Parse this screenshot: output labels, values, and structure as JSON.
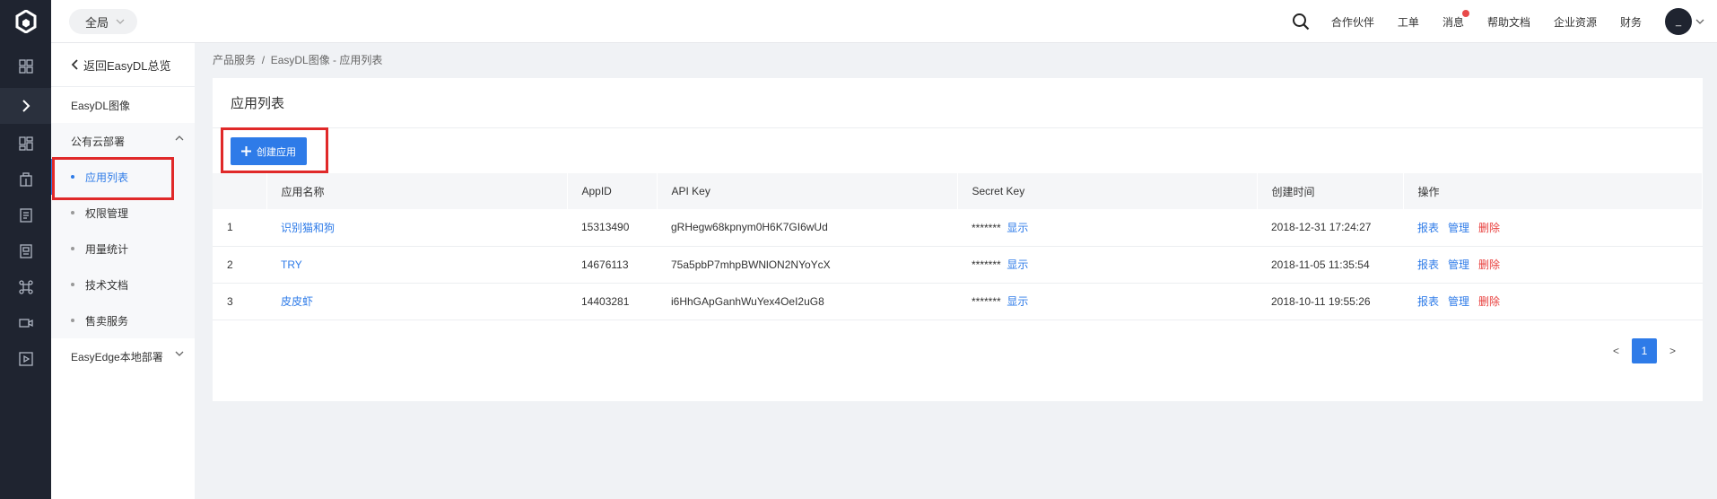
{
  "topbar": {
    "scope": "全局",
    "nav": [
      "合作伙伴",
      "工单",
      "消息",
      "帮助文档",
      "企业资源",
      "财务"
    ],
    "avatar_text": "_"
  },
  "sidebar": {
    "back": "返回EasyDL总览",
    "product": "EasyDL图像",
    "group_public": "公有云部署",
    "sub_items": [
      "应用列表",
      "权限管理",
      "用量统计",
      "技术文档",
      "售卖服务"
    ],
    "group_edge": "EasyEdge本地部署"
  },
  "breadcrumb": {
    "parent": "产品服务",
    "sep": "/",
    "current": "EasyDL图像 - 应用列表"
  },
  "page": {
    "title": "应用列表",
    "create_button": "创建应用"
  },
  "table": {
    "headers": [
      "",
      "应用名称",
      "AppID",
      "API Key",
      "Secret Key",
      "创建时间",
      "操作"
    ],
    "rows": [
      {
        "idx": "1",
        "name": "识别猫和狗",
        "appid": "15313490",
        "apikey": "gRHegw68kpnym0H6K7GI6wUd",
        "secret": "*******",
        "show": "显示",
        "created": "2018-12-31 17:24:27"
      },
      {
        "idx": "2",
        "name": "TRY",
        "appid": "14676113",
        "apikey": "75a5pbP7mhpBWNlON2NYoYcX",
        "secret": "*******",
        "show": "显示",
        "created": "2018-11-05 11:35:54"
      },
      {
        "idx": "3",
        "name": "皮皮虾",
        "appid": "14403281",
        "apikey": "i6HhGApGanhWuYex4OeI2uG8",
        "secret": "*******",
        "show": "显示",
        "created": "2018-10-11 19:55:26"
      }
    ],
    "ops": {
      "report": "报表",
      "manage": "管理",
      "delete": "删除"
    }
  },
  "pagination": {
    "prev": "<",
    "current": "1",
    "next": ">"
  },
  "colors": {
    "accent": "#2e7be8",
    "danger": "#e8403e",
    "rail": "#1f2430",
    "highlight": "#e02929"
  }
}
